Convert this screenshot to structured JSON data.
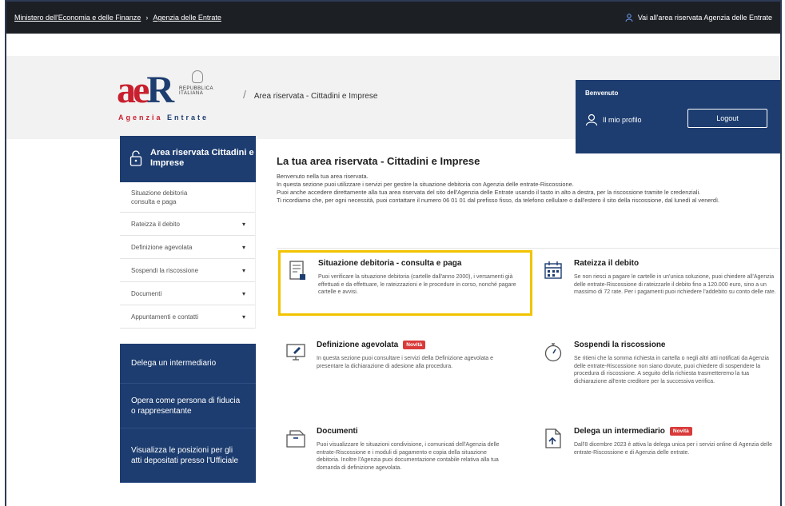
{
  "topbar": {
    "ministry_link": "Ministero dell'Economia e delle Finanze",
    "agency_link": "Agenzia delle Entrate",
    "reserved_link": "Vai all'area riservata Agenzia delle Entrate"
  },
  "header": {
    "logo_text": "aeR",
    "logo_rep": "REPUBBLICA ITALIANA",
    "logo_agency_a": "Agenzia",
    "logo_agency_b": "Entrate",
    "breadcrumb": "Area riservata - Cittadini e Imprese"
  },
  "welcome_box": {
    "title": "Benvenuto",
    "profile_label": "Il mio profilo",
    "logout_label": "Logout"
  },
  "sidebar": {
    "heading": "Area riservata Cittadini e Imprese",
    "items": [
      {
        "label": "Situazione debitoria consulta e paga"
      },
      {
        "label": "Rateizza il debito"
      },
      {
        "label": "Definizione agevolata"
      },
      {
        "label": "Sospendi la riscossione"
      },
      {
        "label": "Documenti"
      },
      {
        "label": "Appuntamenti e contatti"
      }
    ],
    "dark_items": [
      {
        "label": "Delega un intermediario"
      },
      {
        "label": "Opera come persona di fiducia o rappresentante"
      },
      {
        "label": "Visualizza le posizioni per gli atti depositati presso l'Ufficiale"
      }
    ]
  },
  "main": {
    "title": "La tua area riservata - Cittadini e Imprese",
    "intro": [
      "Benvenuto nella tua area riservata.",
      "In questa sezione puoi utilizzare i servizi per gestire la situazione debitoria con Agenzia delle entrate-Riscossione.",
      "Puoi anche accedere direttamente alla tua area riservata del sito dell'Agenzia delle Entrate usando il tasto in alto a destra, per la riscossione tramite le credenziali.",
      "Ti ricordiamo che, per ogni necessità, puoi contattare il numero 06 01 01 dal prefisso fisso, da telefono cellulare o dall'estero il sito della riscossione, dal lunedì al venerdì."
    ],
    "cards": [
      {
        "title": "Situazione debitoria - consulta e paga",
        "badge": "",
        "desc": "Puoi verificare la situazione debitoria (cartelle dall'anno 2000), i versamenti già effettuati e da effettuare, le rateizzazioni e le procedure in corso, nonché pagare cartelle e avvisi."
      },
      {
        "title": "Rateizza il debito",
        "badge": "",
        "desc": "Se non riesci a pagare le cartelle in un'unica soluzione, puoi chiedere all'Agenzia delle entrate-Riscossione di rateizzarle il debito fino a 120.000 euro, sino a un massimo di 72 rate. Per i pagamenti puoi richiedere l'addebito su conto delle rate."
      },
      {
        "title": "Definizione agevolata",
        "badge": "Novità",
        "desc": "In questa sezione puoi consultare i servizi della Definizione agevolata e presentare la dichiarazione di adesione alla procedura."
      },
      {
        "title": "Sospendi la riscossione",
        "badge": "",
        "desc": "Se ritieni che la somma richiesta in cartella o negli altri atti notificati da Agenzia delle entrate-Riscossione non siano dovute, puoi chiedere di sospendere la procedura di riscossione. A seguito della richiesta trasmetteremo la tua dichiarazione all'ente creditore per la successiva verifica."
      },
      {
        "title": "Documenti",
        "badge": "",
        "desc": "Puoi visualizzare le situazioni condivisione, i comunicati dell'Agenzia delle entrate-Riscossione e i moduli di pagamento e copia della situazione debitoria. Inoltre l'Agenzia puoi documentazione contabile relativa alla tua domanda di definizione agevolata."
      },
      {
        "title": "Delega un intermediario",
        "badge": "Novità",
        "desc": "Dall'8 dicembre 2023 è attiva la delega unica per i servizi online di Agenzia delle entrate-Riscossione e di Agenzia delle entrate."
      }
    ]
  },
  "colors": {
    "brand_blue": "#1d3d70",
    "brand_red": "#c8202f",
    "highlight": "#f2c400",
    "badge_red": "#d93a3a",
    "topbar": "#1c1f24"
  }
}
